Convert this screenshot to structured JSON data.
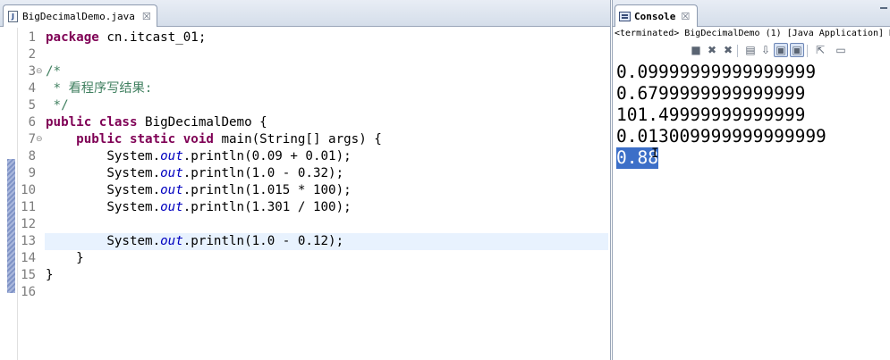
{
  "editor": {
    "tab": {
      "title": "BigDecimalDemo.java",
      "close": "☒",
      "icon": "java-file-icon"
    },
    "lines": [
      {
        "num": "1",
        "fold": "",
        "code": "package cn.itcast_01;"
      },
      {
        "num": "2",
        "fold": "",
        "code": ""
      },
      {
        "num": "3",
        "fold": "⊖",
        "code": "/*"
      },
      {
        "num": "4",
        "fold": "",
        "code": " * 看程序写结果:"
      },
      {
        "num": "5",
        "fold": "",
        "code": " */"
      },
      {
        "num": "6",
        "fold": "",
        "code": "public class BigDecimalDemo {"
      },
      {
        "num": "7",
        "fold": "⊖",
        "code": "    public static void main(String[] args) {"
      },
      {
        "num": "8",
        "fold": "",
        "code": "        System.out.println(0.09 + 0.01);"
      },
      {
        "num": "9",
        "fold": "",
        "code": "        System.out.println(1.0 - 0.32);"
      },
      {
        "num": "10",
        "fold": "",
        "code": "        System.out.println(1.015 * 100);"
      },
      {
        "num": "11",
        "fold": "",
        "code": "        System.out.println(1.301 / 100);"
      },
      {
        "num": "12",
        "fold": "",
        "code": ""
      },
      {
        "num": "13",
        "fold": "",
        "code": "        System.out.println(1.0 - 0.12);",
        "current": true
      },
      {
        "num": "14",
        "fold": "",
        "code": "    }"
      },
      {
        "num": "15",
        "fold": "",
        "code": "}"
      },
      {
        "num": "16",
        "fold": "",
        "code": ""
      }
    ],
    "colors": {
      "keyword": "#7f0055",
      "comment": "#3f7f5f",
      "field": "#0000c0",
      "current_line": "#e8f2fe"
    }
  },
  "console": {
    "tab": {
      "title": "Console",
      "close": "☒",
      "icon": "console-icon"
    },
    "status": "<terminated> BigDecimalDemo (1) [Java Application] D",
    "toolbar": [
      {
        "name": "terminate-button",
        "glyph": "■"
      },
      {
        "name": "remove-launch-button",
        "glyph": "✖"
      },
      {
        "name": "remove-all-terminated-button",
        "glyph": "✖"
      },
      {
        "name": "clear-console-button",
        "glyph": "▤"
      },
      {
        "name": "scroll-lock-button",
        "glyph": "⇩"
      },
      {
        "name": "show-console-stdout-button",
        "glyph": "▣"
      },
      {
        "name": "show-console-stderr-button",
        "glyph": "▣"
      },
      {
        "name": "pin-console-button",
        "glyph": "⇱"
      },
      {
        "name": "display-selected-console-button",
        "glyph": "▭"
      }
    ],
    "output": [
      "0.09999999999999999",
      "0.6799999999999999",
      "101.49999999999999",
      "0.013009999999999999",
      "0.88"
    ],
    "selected_output_index": 4,
    "colors": {
      "selection": "#3c6fc8"
    }
  }
}
